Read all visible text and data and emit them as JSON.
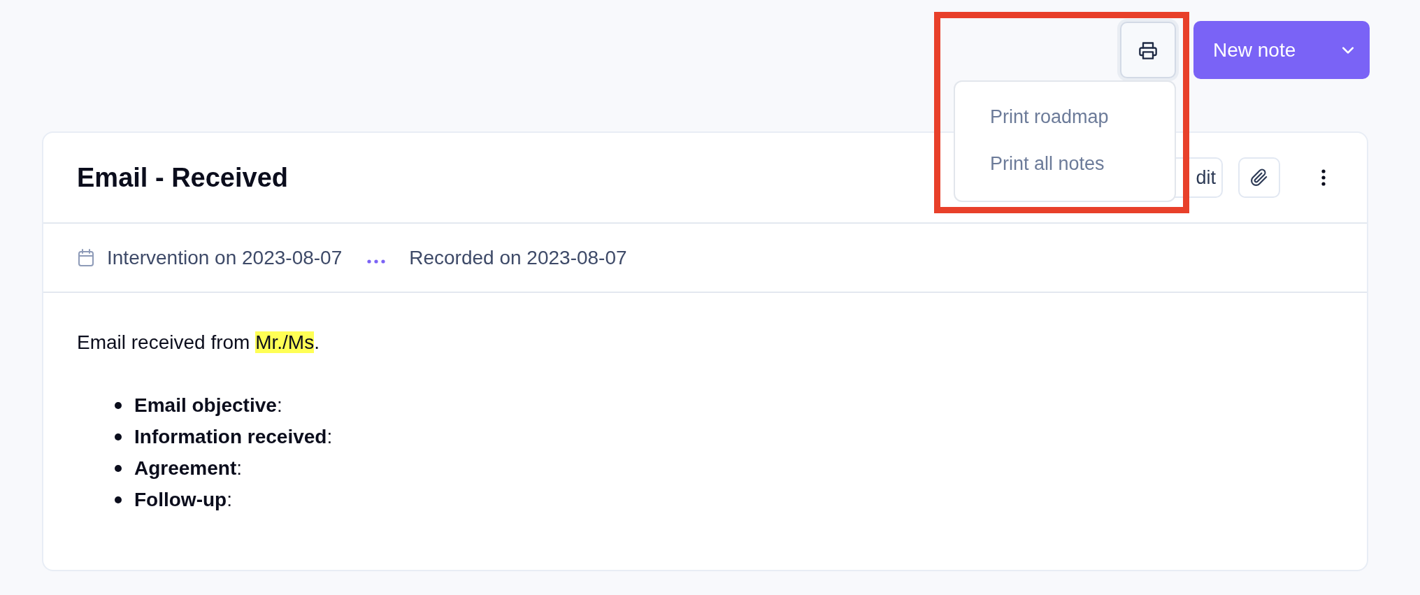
{
  "toolbar": {
    "print_button": {
      "expanded": true
    },
    "new_note_button": {
      "label": "New note"
    }
  },
  "print_menu": {
    "items": [
      {
        "label": "Print roadmap"
      },
      {
        "label": "Print all notes"
      }
    ]
  },
  "annotations": [
    {
      "kind": "frame"
    }
  ],
  "note": {
    "title": "Email - Received",
    "actions": [
      {
        "kind": "edit",
        "label": "dit"
      },
      {
        "kind": "attach"
      },
      {
        "kind": "more"
      }
    ],
    "meta": {
      "intervention": "Intervention on 2023-08-07",
      "recorded": "Recorded on 2023-08-07"
    },
    "body": {
      "paragraph": [
        {
          "text": "Email received from ",
          "highlighted": false
        },
        {
          "text": "Mr./Ms",
          "highlighted": true
        },
        {
          "text": ".",
          "highlighted": false
        }
      ],
      "list": [
        "**Email objective**:",
        "**Information received**:",
        "**Agreement**:",
        "**Follow-up**:"
      ]
    }
  }
}
